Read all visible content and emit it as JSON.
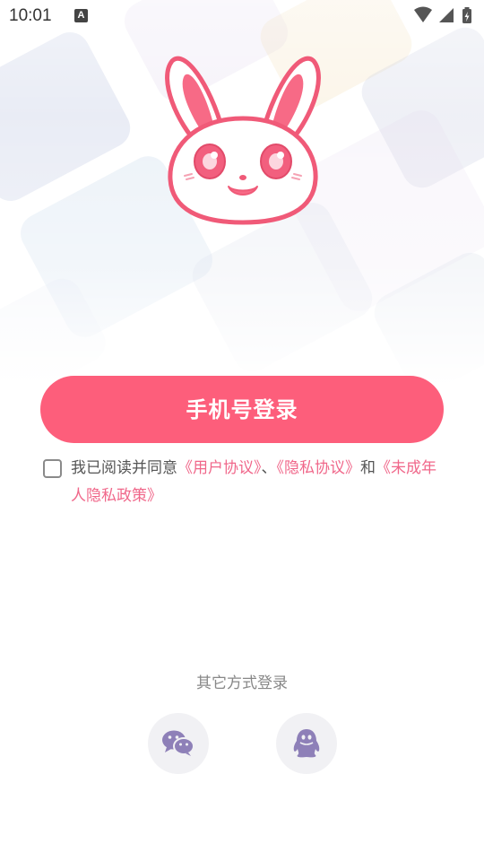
{
  "status_bar": {
    "time": "10:01",
    "notification_badge": "A"
  },
  "login": {
    "phone_button_label": "手机号登录"
  },
  "agreement": {
    "checked": false,
    "prefix": "我已阅读并同意",
    "user_agreement": "《用户协议》",
    "sep1": "、",
    "privacy_agreement": "《隐私协议》",
    "sep2": "和",
    "minor_privacy_policy": "《未成年人隐私政策》"
  },
  "other_login": {
    "title": "其它方式登录",
    "methods": [
      {
        "icon": "wechat-icon"
      },
      {
        "icon": "qq-icon"
      }
    ]
  },
  "colors": {
    "accent": "#fd5e7b",
    "link": "#f0678a",
    "social_icon": "#8e80b8"
  }
}
